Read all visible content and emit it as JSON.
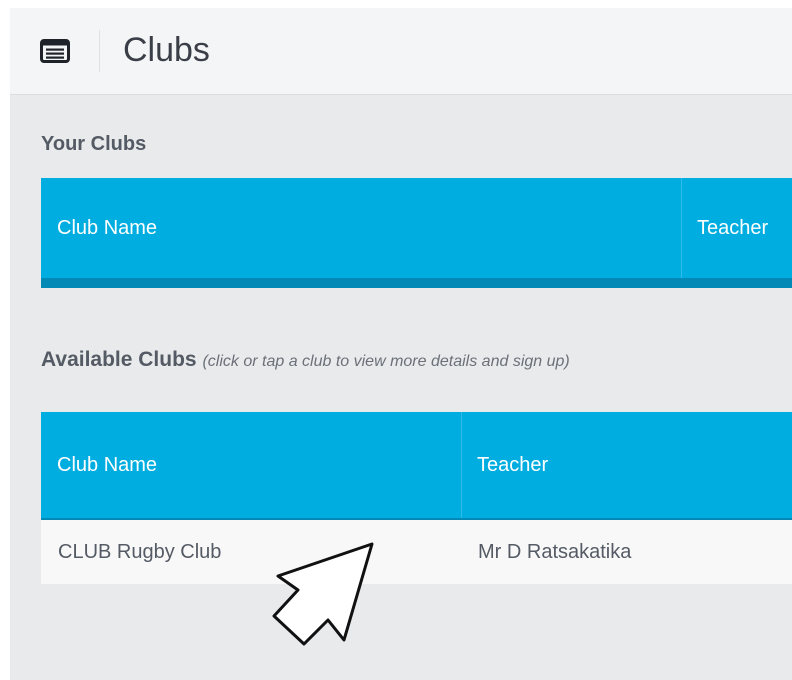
{
  "header": {
    "title": "Clubs",
    "icon": "list-card-icon"
  },
  "your_clubs": {
    "title": "Your Clubs",
    "columns": [
      "Club Name",
      "Teacher"
    ]
  },
  "available_clubs": {
    "title": "Available Clubs",
    "hint": "(click or tap a club to view more details and sign up)",
    "columns": [
      "Club Name",
      "Teacher"
    ],
    "rows": [
      {
        "club_name": "CLUB Rugby Club",
        "teacher": "Mr D Ratsakatika"
      }
    ]
  },
  "colors": {
    "table_header": "#00ade0",
    "table_header_border": "#0289b5",
    "background": "#e9eaec"
  },
  "cursor": "pointer-arrow-icon"
}
